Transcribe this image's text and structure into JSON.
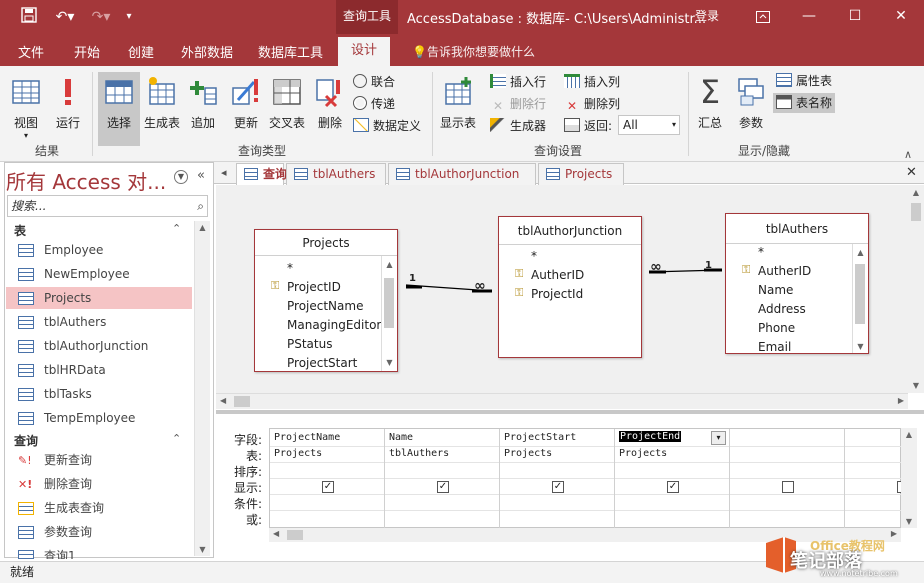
{
  "titlebar": {
    "context_tool": "查询工具",
    "title": "AccessDatabase : 数据库- C:\\Users\\Administr...",
    "login": "登录"
  },
  "ribbon_tabs": [
    "文件",
    "开始",
    "创建",
    "外部数据",
    "数据库工具",
    "设计"
  ],
  "tell_me": "告诉我你想要做什么",
  "ribbon": {
    "results": {
      "label": "结果",
      "view": "视图",
      "run": "运行"
    },
    "query_type": {
      "label": "查询类型",
      "select": "选择",
      "make_table": "生成表",
      "append": "追加",
      "update": "更新",
      "crosstab": "交叉表",
      "delete": "删除",
      "union": "联合",
      "pass_through": "传递",
      "data_definition": "数据定义"
    },
    "query_setup": {
      "label": "查询设置",
      "show_table": "显示表",
      "insert_rows": "插入行",
      "delete_rows": "删除行",
      "builder": "生成器",
      "insert_columns": "插入列",
      "delete_columns": "删除列",
      "return_label": "返回:",
      "return_value": "All"
    },
    "show_hide": {
      "label": "显示/隐藏",
      "totals": "汇总",
      "parameters": "参数",
      "property_sheet": "属性表",
      "table_names": "表名称"
    }
  },
  "nav": {
    "title": "所有 Access 对...",
    "search_placeholder": "搜索...",
    "tables_header": "表",
    "tables": [
      "Employee",
      "NewEmployee",
      "Projects",
      "tblAuthers",
      "tblAuthorJunction",
      "tblHRData",
      "tblTasks",
      "TempEmployee"
    ],
    "queries_header": "查询",
    "queries": [
      "更新查询",
      "删除查询",
      "生成表查询",
      "参数查询",
      "查询1"
    ]
  },
  "doc_tabs": [
    "查询4",
    "tblAuthers",
    "tblAuthorJunction",
    "Projects"
  ],
  "tables": {
    "projects": {
      "title": "Projects",
      "fields": [
        "*",
        "ProjectID",
        "ProjectName",
        "ManagingEditor",
        "PStatus",
        "ProjectStart"
      ]
    },
    "junction": {
      "title": "tblAuthorJunction",
      "fields": [
        "*",
        "AutherID",
        "ProjectId"
      ]
    },
    "authers": {
      "title": "tblAuthers",
      "fields": [
        "*",
        "AutherID",
        "Name",
        "Address",
        "Phone",
        "Email"
      ]
    }
  },
  "relations": {
    "one": "1",
    "many": "∞"
  },
  "grid": {
    "row_labels": [
      "字段:",
      "表:",
      "排序:",
      "显示:",
      "条件:",
      "或:"
    ],
    "columns": [
      {
        "field": "ProjectName",
        "table": "Projects",
        "show": true
      },
      {
        "field": "Name",
        "table": "tblAuthers",
        "show": true
      },
      {
        "field": "ProjectStart",
        "table": "Projects",
        "show": true
      },
      {
        "field": "ProjectEnd",
        "table": "Projects",
        "show": true
      },
      {
        "field": "",
        "table": "",
        "show": false
      },
      {
        "field": "",
        "table": "",
        "show": false
      }
    ]
  },
  "status": {
    "text": "就绪"
  },
  "watermark": {
    "brand": "Office教程网",
    "cn": "笔记部落",
    "url": "www.notetribe.com"
  },
  "colors": {
    "accent": "#a4373a",
    "selected_row": "#f5c4c5"
  }
}
